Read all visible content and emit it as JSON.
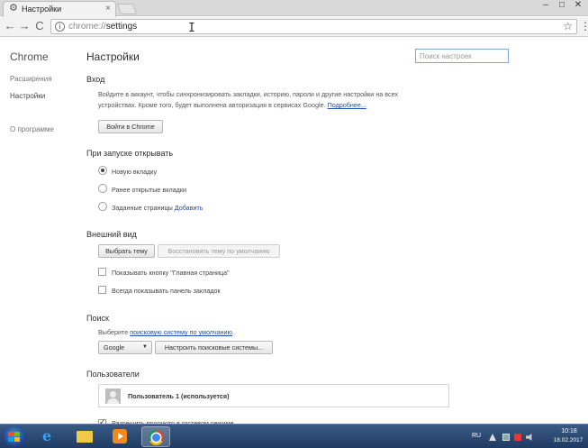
{
  "tab": {
    "title": "Настройки",
    "close": "×"
  },
  "window_controls": {
    "minimize": "–",
    "maximize": "□",
    "close": "✕"
  },
  "toolbar": {
    "back": "←",
    "forward": "→",
    "reload": "C",
    "url_scheme": "chrome://",
    "url_path": "settings",
    "star": "☆",
    "menu": "⋮"
  },
  "sidebar": {
    "title": "Chrome",
    "items": [
      {
        "label": "Расширения",
        "active": false
      },
      {
        "label": "Настройки",
        "active": true
      },
      {
        "label": "О программе",
        "active": false
      }
    ]
  },
  "main": {
    "title": "Настройки",
    "search_placeholder": "Поиск настроек",
    "signin": {
      "title": "Вход",
      "line1": "Войдите в аккаунт, чтобы синхронизировать закладки, историю, пароли и другие настройки на всех",
      "line2": "устройствах. Кроме того, будет выполнена авторизация в сервисах Google.",
      "more_link": "Подробнее...",
      "button": "Войти в Chrome"
    },
    "startup": {
      "title": "При запуске открывать",
      "options": [
        {
          "label": "Новую вкладку",
          "selected": true
        },
        {
          "label": "Ранее открытые вкладки",
          "selected": false
        },
        {
          "label": "Заданные страницы",
          "selected": false
        }
      ],
      "add_link": "Добавить"
    },
    "appearance": {
      "title": "Внешний вид",
      "theme_button": "Выбрать тему",
      "reset_button": "Восстановить тему по умолчанию",
      "home_button_label": "Показывать кнопку \"Главная страница\"",
      "bookmarks_bar_label": "Всегда показывать панель закладок"
    },
    "search": {
      "title": "Поиск",
      "text_prefix": "Выберите",
      "link": "поисковую систему по умолчанию",
      "text_suffix": ".",
      "engine": "Google",
      "manage_button": "Настроить поисковые системы..."
    },
    "users": {
      "title": "Пользователи",
      "current_user": "Пользователь 1 (используется)",
      "guest_label": "Разрешить просмотр в гостевом режиме"
    }
  },
  "taskbar": {
    "lang": "RU",
    "time": "10:18",
    "date": "18.02.2017"
  }
}
